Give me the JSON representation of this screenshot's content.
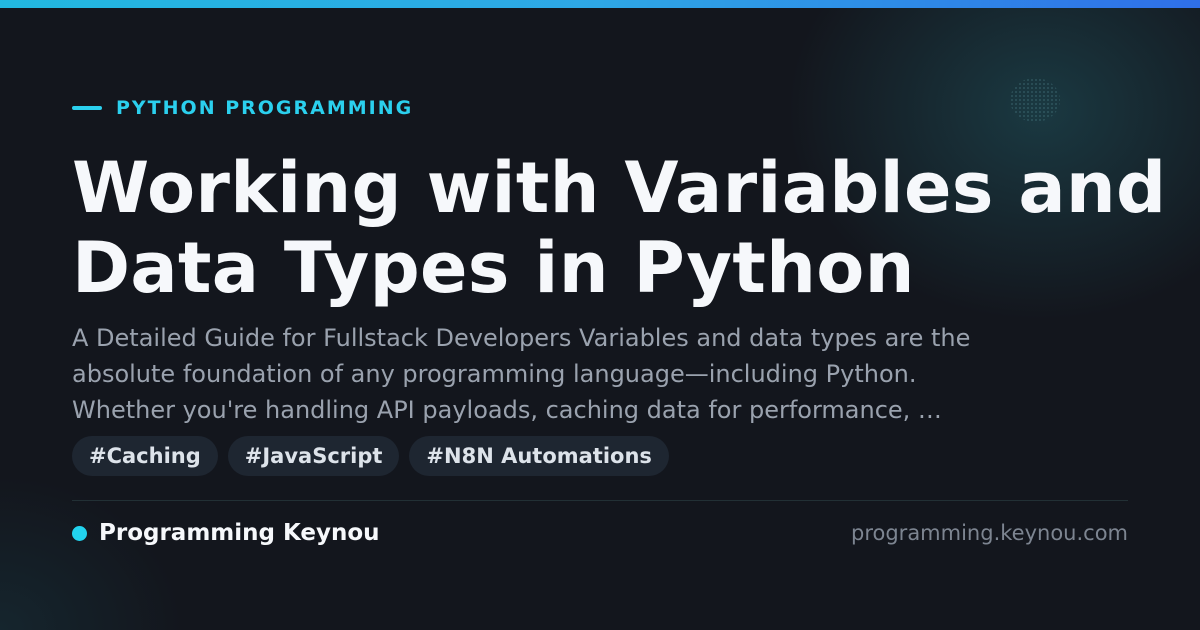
{
  "colors": {
    "background": "#13161d",
    "accent": "#2bd0ee",
    "title": "#f6f8fb",
    "description": "#9aa2ae",
    "tag_background": "#1e2631",
    "tag_text": "#dde3ea",
    "muted": "#7d8591"
  },
  "header": {
    "category": "PYTHON PROGRAMMING"
  },
  "article": {
    "title_lines": [
      "Working with Variables and",
      "Data Types in Python"
    ],
    "description_lines": [
      "A Detailed Guide for Fullstack Developers Variables and data types are the",
      "absolute foundation of any programming language—including Python.",
      "Whether you're handling API payloads, caching data for performance, …"
    ],
    "tags": [
      "#Caching",
      "#JavaScript",
      "#N8N Automations"
    ]
  },
  "footer": {
    "brand_name": "Programming Keynou",
    "site_url": "programming.keynou.com"
  }
}
